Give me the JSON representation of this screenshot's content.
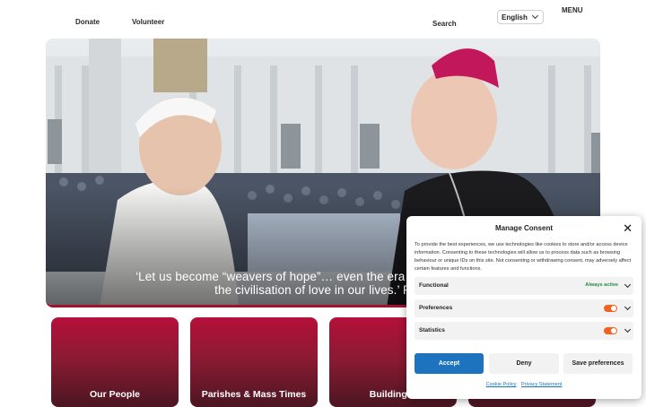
{
  "header": {
    "donate": "Donate",
    "volunteer": "Volunteer",
    "search": "Search",
    "language": "English",
    "menu": "MENU"
  },
  "hero": {
    "quote_line1": "‘Let us become “weavers of hope”… even the era of AI can be a time",
    "quote_line2": "the civilisation of love in our lives.’ Pope"
  },
  "cards": [
    {
      "label": "Our People"
    },
    {
      "label": "Parishes & Mass Times"
    },
    {
      "label": "Building H"
    },
    {
      "label": ""
    }
  ],
  "consent": {
    "title": "Manage Consent",
    "body": "To provide the best experiences, we use technologies like cookies to store and/or access device information. Consenting to these technologies will allow us to process data such as browsing behaviour or unique IDs on this site. Not consenting or withdrawing consent, may adversely affect certain features and functions.",
    "preferences": [
      {
        "label": "Functional",
        "status": "Always active"
      },
      {
        "label": "Preferences",
        "status": ""
      },
      {
        "label": "Statistics",
        "status": ""
      }
    ],
    "accept": "Accept",
    "deny": "Deny",
    "save": "Save preferences",
    "cookie_policy": "Cookie Policy",
    "privacy": "Privacy Statement",
    "close_icon": "close-icon",
    "toggle_color": "#f26322",
    "accept_color": "#1e73be"
  },
  "colors": {
    "brand_red": "#a3112d"
  }
}
